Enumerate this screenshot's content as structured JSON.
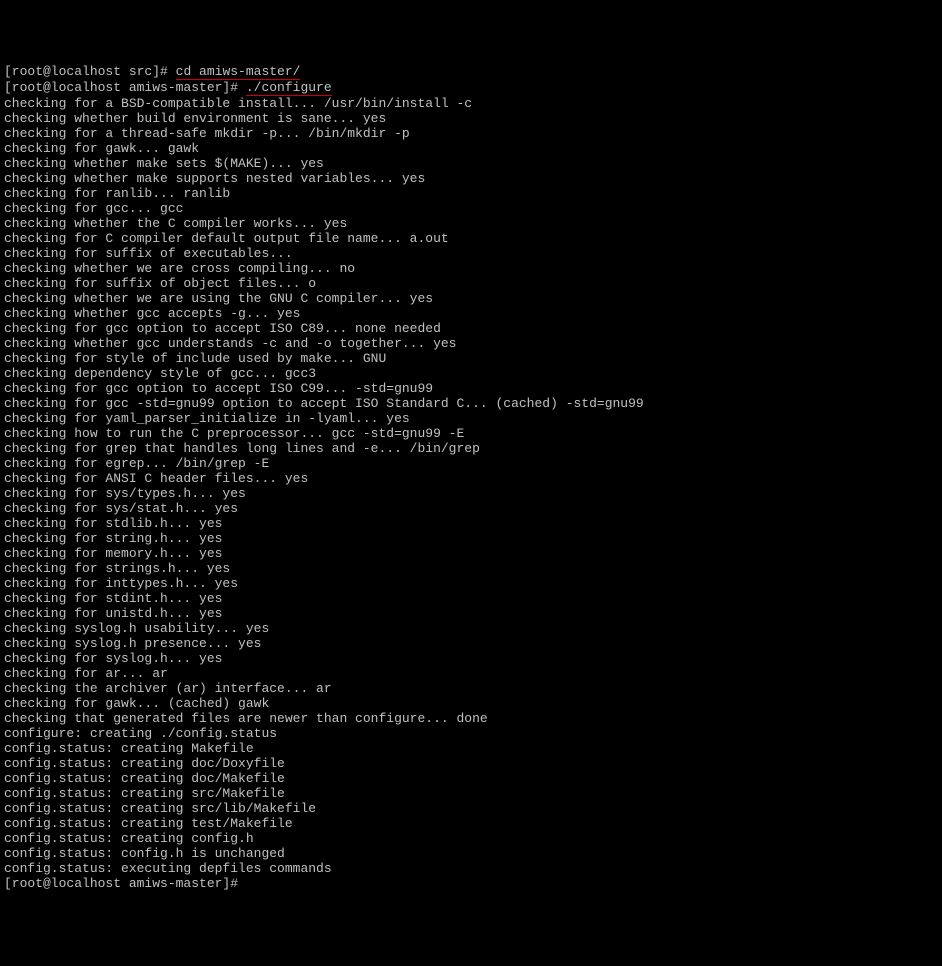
{
  "lines": [
    {
      "type": "prompt",
      "prefix": "[root@localhost src]# ",
      "cmd": "cd amiws-master/",
      "underline": true
    },
    {
      "type": "prompt",
      "prefix": "[root@localhost amiws-master]# ",
      "cmd": "./configure",
      "underline": true
    },
    {
      "type": "output",
      "text": "checking for a BSD-compatible install... /usr/bin/install -c"
    },
    {
      "type": "output",
      "text": "checking whether build environment is sane... yes"
    },
    {
      "type": "output",
      "text": "checking for a thread-safe mkdir -p... /bin/mkdir -p"
    },
    {
      "type": "output",
      "text": "checking for gawk... gawk"
    },
    {
      "type": "output",
      "text": "checking whether make sets $(MAKE)... yes"
    },
    {
      "type": "output",
      "text": "checking whether make supports nested variables... yes"
    },
    {
      "type": "output",
      "text": "checking for ranlib... ranlib"
    },
    {
      "type": "output",
      "text": "checking for gcc... gcc"
    },
    {
      "type": "output",
      "text": "checking whether the C compiler works... yes"
    },
    {
      "type": "output",
      "text": "checking for C compiler default output file name... a.out"
    },
    {
      "type": "output",
      "text": "checking for suffix of executables..."
    },
    {
      "type": "output",
      "text": "checking whether we are cross compiling... no"
    },
    {
      "type": "output",
      "text": "checking for suffix of object files... o"
    },
    {
      "type": "output",
      "text": "checking whether we are using the GNU C compiler... yes"
    },
    {
      "type": "output",
      "text": "checking whether gcc accepts -g... yes"
    },
    {
      "type": "output",
      "text": "checking for gcc option to accept ISO C89... none needed"
    },
    {
      "type": "output",
      "text": "checking whether gcc understands -c and -o together... yes"
    },
    {
      "type": "output",
      "text": "checking for style of include used by make... GNU"
    },
    {
      "type": "output",
      "text": "checking dependency style of gcc... gcc3"
    },
    {
      "type": "output",
      "text": "checking for gcc option to accept ISO C99... -std=gnu99"
    },
    {
      "type": "output",
      "text": "checking for gcc -std=gnu99 option to accept ISO Standard C... (cached) -std=gnu99"
    },
    {
      "type": "output",
      "text": "checking for yaml_parser_initialize in -lyaml... yes"
    },
    {
      "type": "output",
      "text": "checking how to run the C preprocessor... gcc -std=gnu99 -E"
    },
    {
      "type": "output",
      "text": "checking for grep that handles long lines and -e... /bin/grep"
    },
    {
      "type": "output",
      "text": "checking for egrep... /bin/grep -E"
    },
    {
      "type": "output",
      "text": "checking for ANSI C header files... yes"
    },
    {
      "type": "output",
      "text": "checking for sys/types.h... yes"
    },
    {
      "type": "output",
      "text": "checking for sys/stat.h... yes"
    },
    {
      "type": "output",
      "text": "checking for stdlib.h... yes"
    },
    {
      "type": "output",
      "text": "checking for string.h... yes"
    },
    {
      "type": "output",
      "text": "checking for memory.h... yes"
    },
    {
      "type": "output",
      "text": "checking for strings.h... yes"
    },
    {
      "type": "output",
      "text": "checking for inttypes.h... yes"
    },
    {
      "type": "output",
      "text": "checking for stdint.h... yes"
    },
    {
      "type": "output",
      "text": "checking for unistd.h... yes"
    },
    {
      "type": "output",
      "text": "checking syslog.h usability... yes"
    },
    {
      "type": "output",
      "text": "checking syslog.h presence... yes"
    },
    {
      "type": "output",
      "text": "checking for syslog.h... yes"
    },
    {
      "type": "output",
      "text": "checking for ar... ar"
    },
    {
      "type": "output",
      "text": "checking the archiver (ar) interface... ar"
    },
    {
      "type": "output",
      "text": "checking for gawk... (cached) gawk"
    },
    {
      "type": "output",
      "text": "checking that generated files are newer than configure... done"
    },
    {
      "type": "output",
      "text": "configure: creating ./config.status"
    },
    {
      "type": "output",
      "text": "config.status: creating Makefile"
    },
    {
      "type": "output",
      "text": "config.status: creating doc/Doxyfile"
    },
    {
      "type": "output",
      "text": "config.status: creating doc/Makefile"
    },
    {
      "type": "output",
      "text": "config.status: creating src/Makefile"
    },
    {
      "type": "output",
      "text": "config.status: creating src/lib/Makefile"
    },
    {
      "type": "output",
      "text": "config.status: creating test/Makefile"
    },
    {
      "type": "output",
      "text": "config.status: creating config.h"
    },
    {
      "type": "output",
      "text": "config.status: config.h is unchanged"
    },
    {
      "type": "output",
      "text": "config.status: executing depfiles commands"
    },
    {
      "type": "prompt",
      "prefix": "[root@localhost amiws-master]# ",
      "cmd": "",
      "underline": false
    }
  ]
}
